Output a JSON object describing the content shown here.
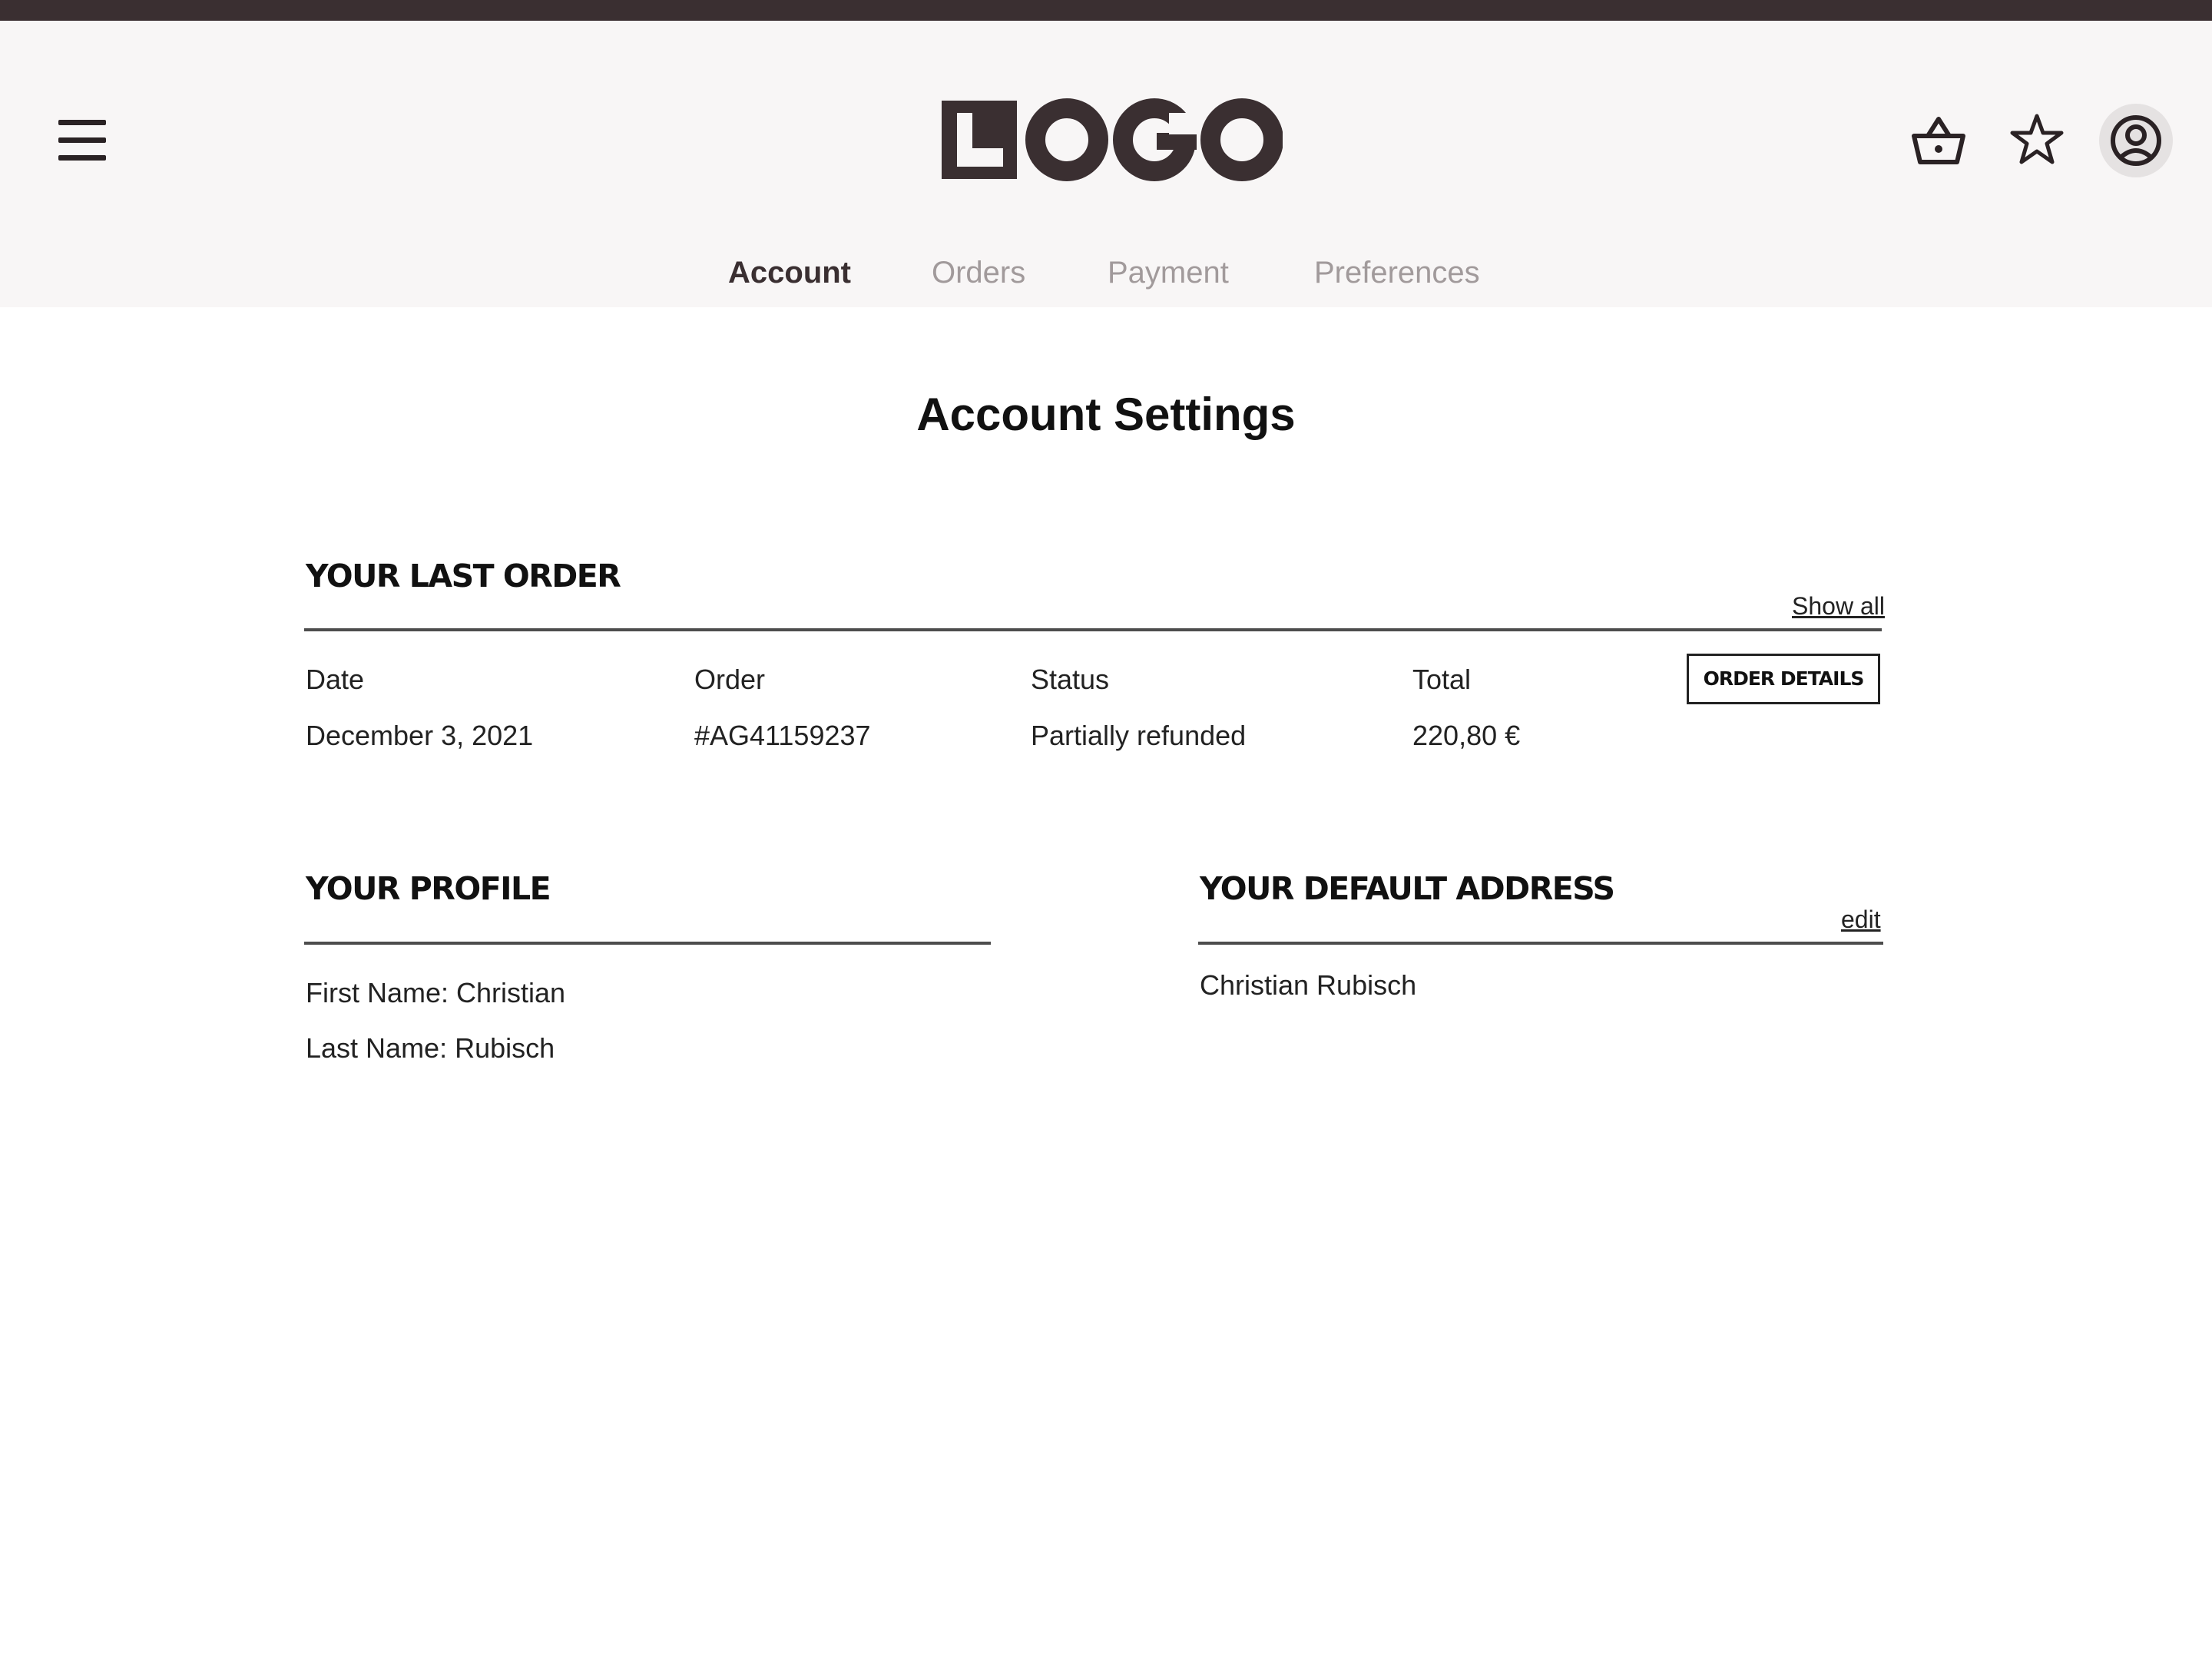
{
  "header": {
    "logo_text": "LOGO",
    "menu_icon": "hamburger-menu-icon",
    "actions": [
      {
        "icon": "basket-icon"
      },
      {
        "icon": "star-icon"
      },
      {
        "icon": "user-account-icon"
      }
    ]
  },
  "tabs": [
    {
      "label": "Account",
      "active": true
    },
    {
      "label": "Orders",
      "active": false
    },
    {
      "label": "Payment",
      "active": false
    },
    {
      "label": "Preferences",
      "active": false
    }
  ],
  "page_title": "Account Settings",
  "last_order": {
    "title": "YOUR LAST ORDER",
    "show_all": "Show all",
    "columns": [
      "Date",
      "Order",
      "Status",
      "Total"
    ],
    "values": [
      "December 3, 2021",
      "#AG41159237",
      "Partially refunded",
      "220,80 €"
    ],
    "details_button": "ORDER DETAILS"
  },
  "profile": {
    "title": "YOUR PROFILE",
    "first_name": "First Name: Christian",
    "last_name": "Last Name: Rubisch"
  },
  "address": {
    "title": "YOUR DEFAULT ADDRESS",
    "edit": "edit",
    "name": "Christian Rubisch"
  },
  "colors": {
    "topbar": "#3a2f31",
    "header_bg": "#f8f6f6",
    "tab_active": "#3a2f31",
    "tab_inactive": "#a19a9b",
    "avatar_bg": "#e5e2e2"
  }
}
